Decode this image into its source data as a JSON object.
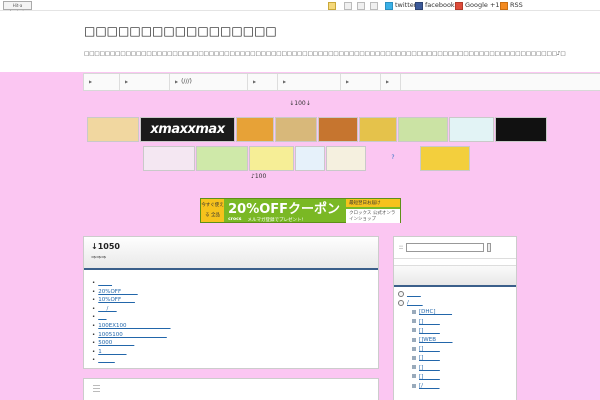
{
  "topbar": {
    "hit_badge": "Hit-a Analysis",
    "share": [
      {
        "icon": "pencil-icon",
        "label": ""
      },
      {
        "icon": "page-icon",
        "label": ""
      },
      {
        "icon": "mail-icon",
        "label": ""
      },
      {
        "icon": "print-icon",
        "label": ""
      },
      {
        "icon": "twitter-icon",
        "label": "twitter"
      },
      {
        "icon": "facebook-icon",
        "label": "facebook"
      },
      {
        "icon": "google-plus-icon",
        "label": "Google +1"
      },
      {
        "icon": "rss-icon",
        "label": "RSS"
      }
    ]
  },
  "header": {
    "title": "□□□□□□□□□□□□□□□□□",
    "description": "□□□□□□□□□□□□□□□□□□□□□□□□□□□□□□□□□□□□□□□□□□□□□□□□□□□□□□□□□□□□□□□□□□□□□□□□□□□□□□□□□□□□□□□□□□□♪□"
  },
  "nav": [
    {
      "label": ""
    },
    {
      "label": ""
    },
    {
      "label": "(///)"
    },
    {
      "label": ""
    },
    {
      "label": ""
    },
    {
      "label": ""
    },
    {
      "label": ""
    }
  ],
  "ads": {
    "note_top": "↓100↓",
    "row1": [
      {
        "text": "",
        "color": "#f1d7a0"
      },
      {
        "text": "xmaxxmax",
        "color": "#1b1b1b"
      },
      {
        "text": "",
        "color": "#e7a237"
      },
      {
        "text": "",
        "color": "#d8b87a"
      },
      {
        "text": "",
        "color": "#c6752f"
      },
      {
        "text": "",
        "color": "#e5c24b"
      },
      {
        "text": "",
        "color": "#cbe3a4"
      },
      {
        "text": "",
        "color": "#e2f3f5"
      },
      {
        "text": "",
        "color": "#111"
      }
    ],
    "row2": [
      {
        "text": "",
        "color": "#f4e7f2"
      },
      {
        "text": "",
        "color": "#cfe9a9"
      },
      {
        "text": "",
        "color": "#f6ee96"
      },
      {
        "text": "",
        "color": "#e6f1fa"
      },
      {
        "text": "",
        "color": "#f5f0df"
      },
      {
        "text": "?",
        "color": "#2b6fc2"
      },
      {
        "text": "",
        "color": "#f3cf3d"
      }
    ],
    "note_bottom": "♪100"
  },
  "banner": {
    "tag": "今すぐ使える 全品",
    "headline": "20%OFFクーポン",
    "brand": "crocs",
    "sub_right_top": "最短翌日お届け",
    "sub_right_bottom": "クロックス 公式オンラインショップ",
    "sub_bottom": "メルマガ登録でプレゼント!"
  },
  "post": {
    "title": "↓1050",
    "subtitle": "⇒⇒⇒",
    "links": [
      "_____",
      "20%OFF______",
      "10%OFF_____",
      "___/___",
      "___",
      "100EX100________________",
      "1005100________________",
      "5000________",
      "1_________",
      "______"
    ]
  },
  "sidebar": {
    "search_label": "::",
    "search_placeholder": "",
    "section_head": "",
    "items": [
      {
        "text": "_____",
        "child": false
      },
      {
        "text": "/_____",
        "child": false
      },
      {
        "text": "[DHC]______",
        "child": true
      },
      {
        "text": "[]______",
        "child": true
      },
      {
        "text": "[]______",
        "child": true
      },
      {
        "text": "[]WEB______",
        "child": true
      },
      {
        "text": "[]______",
        "child": true
      },
      {
        "text": "[]______",
        "child": true
      },
      {
        "text": "[]______",
        "child": true
      },
      {
        "text": "[]______",
        "child": true
      },
      {
        "text": "[/______",
        "child": true
      }
    ]
  }
}
